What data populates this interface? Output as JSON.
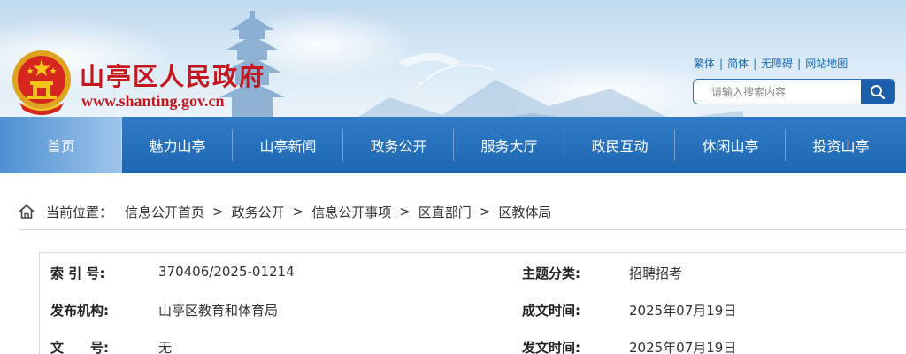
{
  "header": {
    "site_name": "山亭区人民政府",
    "site_domain": "www.shanting.gov.cn",
    "top_links": [
      "繁体",
      "简体",
      "无障碍",
      "网站地图"
    ],
    "search": {
      "placeholder": "请输入搜索内容"
    }
  },
  "nav": {
    "items": [
      "首页",
      "魅力山亭",
      "山亭新闻",
      "政务公开",
      "服务大厅",
      "政民互动",
      "休闲山亭",
      "投资山亭"
    ]
  },
  "breadcrumb": {
    "label": "当前位置：",
    "items": [
      "信息公开首页",
      "政务公开",
      "信息公开事项",
      "区直部门",
      "区教体局"
    ],
    "separator": ">"
  },
  "info": {
    "rows": [
      {
        "label1": "索 引 号:",
        "value1": "370406/2025-01214",
        "label2": "主题分类:",
        "value2": "招聘招考"
      },
      {
        "label1": "发布机构:",
        "value1": "山亭区教育和体育局",
        "label2": "成文时间:",
        "value2": "2025年07月19日"
      },
      {
        "label1": "文　　号:",
        "value1": "无",
        "label2": "发文时间:",
        "value2": "2025年07月19日"
      }
    ]
  },
  "colors": {
    "nav_bg": "#1f66b1",
    "brand_red": "#c4161c",
    "link_blue": "#1a6bb8"
  },
  "icons": [
    "national-emblem-icon",
    "search-icon",
    "home-icon"
  ]
}
